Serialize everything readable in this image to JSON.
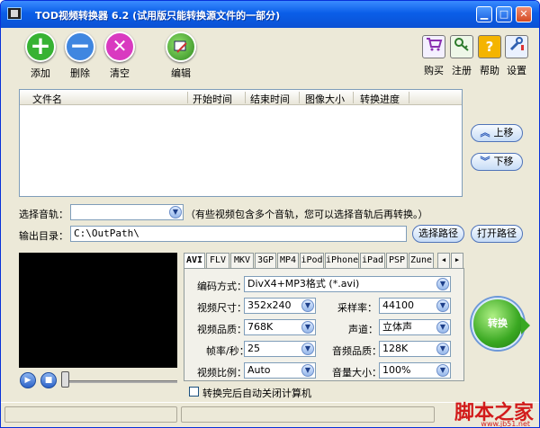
{
  "window": {
    "title": "TOD视频转换器 6.2 (试用版只能转换源文件的一部分)",
    "min_glyph": "▁",
    "max_glyph": "□",
    "close_glyph": "✕"
  },
  "toolbar": {
    "add": {
      "label": "添加",
      "glyph": "+"
    },
    "remove": {
      "label": "删除",
      "glyph": "−"
    },
    "clear": {
      "label": "清空",
      "glyph": "✕"
    },
    "edit": {
      "label": "编辑"
    },
    "buy": {
      "label": "购买"
    },
    "register": {
      "label": "注册"
    },
    "help": {
      "label": "帮助",
      "glyph": "?"
    },
    "settings": {
      "label": "设置"
    }
  },
  "file_list": {
    "columns": [
      "文件名",
      "开始时间",
      "结束时间",
      "图像大小",
      "转换进度"
    ],
    "rows": []
  },
  "side": {
    "move_up": "上移",
    "move_down": "下移"
  },
  "audio_track": {
    "label": "选择音轨：",
    "value": "",
    "hint": "（有些视频包含多个音轨，您可以选择音轨后再转换。）"
  },
  "output": {
    "label": "输出目录：",
    "path": "C:\\OutPath\\",
    "choose_button": "选择路径",
    "open_button": "打开路径"
  },
  "format_tabs": [
    "AVI",
    "FLV",
    "MKV",
    "3GP",
    "MP4",
    "iPod",
    "iPhone",
    "iPad",
    "PSP",
    "Zune"
  ],
  "active_tab": "AVI",
  "settings": {
    "codec": {
      "label": "编码方式：",
      "value": "DivX4+MP3格式 (*.avi)"
    },
    "video_size": {
      "label": "视频尺寸：",
      "value": "352x240"
    },
    "sample_rate": {
      "label": "采样率：",
      "value": "44100"
    },
    "video_quality": {
      "label": "视频品质：",
      "value": "768K"
    },
    "channel": {
      "label": "声道：",
      "value": "立体声"
    },
    "frame_rate": {
      "label": "帧率/秒：",
      "value": "25"
    },
    "audio_quality": {
      "label": "音频品质：",
      "value": "128K"
    },
    "aspect_ratio": {
      "label": "视频比例：",
      "value": "Auto"
    },
    "volume": {
      "label": "音量大小：",
      "value": "100%"
    }
  },
  "convert_button": "转换",
  "shutdown_checkbox": {
    "label": "转换完后自动关闭计算机",
    "checked": false
  },
  "player": {
    "play_glyph": "▶",
    "stop_glyph": "■",
    "position": 0
  },
  "watermark": {
    "text": "脚本之家",
    "url": "www.jb51.net"
  },
  "colors": {
    "titlebar": "#0a5ee8",
    "add": "#37b233",
    "remove": "#3f86e0",
    "clear": "#d93ac0",
    "convert": "#3aa822"
  }
}
